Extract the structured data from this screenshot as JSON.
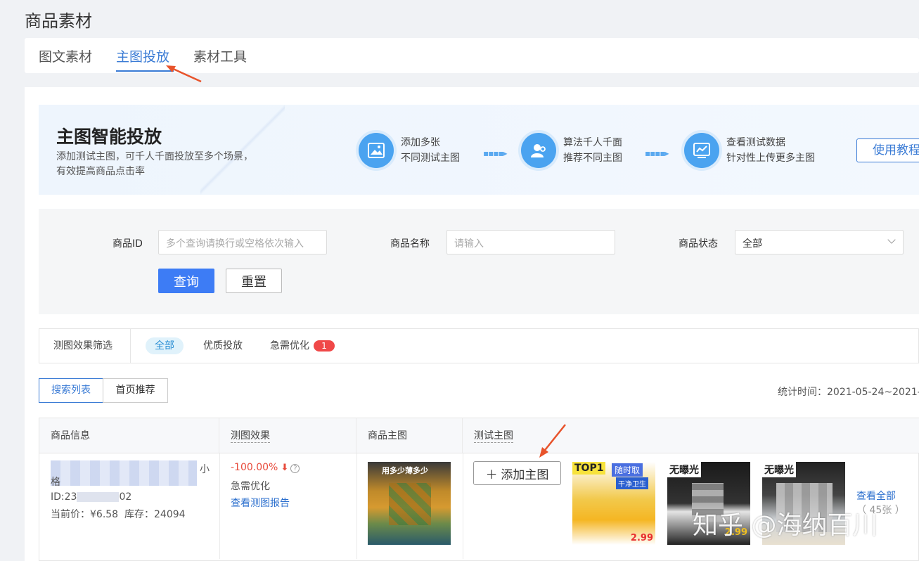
{
  "page": {
    "title": "商品素材"
  },
  "tabs": [
    {
      "label": "图文素材",
      "active": false
    },
    {
      "label": "主图投放",
      "active": true
    },
    {
      "label": "素材工具",
      "active": false
    }
  ],
  "banner": {
    "title": "主图智能投放",
    "desc_line1": "添加测试主图，可千人千面投放至多个场景，",
    "desc_line2": "有效提高商品点击率",
    "steps": [
      {
        "line1": "添加多张",
        "line2": "不同测试主图",
        "icon": "image-icon"
      },
      {
        "line1": "算法千人千面",
        "line2": "推荐不同主图",
        "icon": "users-icon"
      },
      {
        "line1": "查看测试数据",
        "line2": "针对性上传更多主图",
        "icon": "chart-icon"
      }
    ],
    "tutorial_button": "使用教程"
  },
  "filters": {
    "product_id_label": "商品ID",
    "product_id_placeholder": "多个查询请换行或空格依次输入",
    "product_name_label": "商品名称",
    "product_name_placeholder": "请输入",
    "status_label": "商品状态",
    "status_value": "全部",
    "query_button": "查询",
    "reset_button": "重置"
  },
  "effect_filter": {
    "label": "测图效果筛选",
    "options": [
      "全部",
      "优质投放",
      "急需优化"
    ],
    "urgent_count": "1"
  },
  "view_switch": {
    "search_list": "搜索列表",
    "home_recommend": "首页推荐"
  },
  "stat_time": "统计时间：2021-05-24~2021-",
  "table": {
    "headers": [
      "商品信息",
      "测图效果",
      "商品主图",
      "测试主图"
    ],
    "row": {
      "name_tail1": "小",
      "name_head2": "格",
      "id_prefix": "ID:23",
      "id_suffix": "02",
      "price": "当前价：¥6.58",
      "stock": "库存：24094",
      "effect_value": "-100.00%",
      "effect_status": "急需优化",
      "report_link": "查看测图报告",
      "add_button": "添加主图",
      "test_images": [
        {
          "tag": "TOP1",
          "caption": "随时取",
          "sub": "干净卫生",
          "price": "2.99"
        },
        {
          "tag": "无曝光",
          "price": "2.99"
        },
        {
          "tag": "无曝光"
        }
      ],
      "main_image_caption": "用多少薄多少",
      "view_all": "查看全部",
      "view_all_count": "（ 45张 ）"
    }
  },
  "watermark": "知乎 @海纳百川",
  "colors": {
    "primary": "#3a7bd5",
    "button_blue": "#3d7cf5",
    "danger": "#e84c3d",
    "annotation": "#e8532b"
  }
}
